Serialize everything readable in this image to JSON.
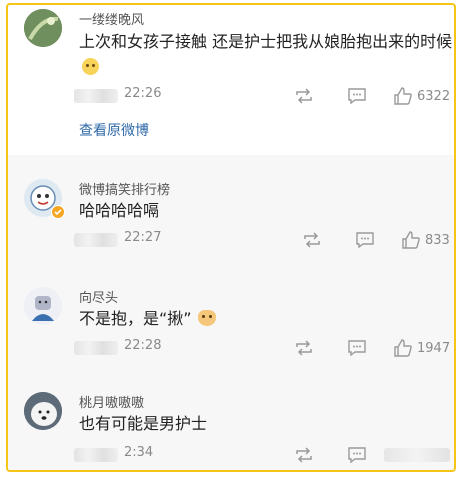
{
  "colors": {
    "frame": "#f5c518",
    "link": "#2f6aa8",
    "meta": "#8a8a8a"
  },
  "comments": [
    {
      "username": "一缕缕晚风",
      "text": "上次和女孩子接触 还是护士把我从娘胎抱出来的时候",
      "emoji": "blush-emoji-icon",
      "time": "22:26",
      "likes": "6322",
      "link": "查看原微博"
    },
    {
      "username": "微博搞笑排行榜",
      "text": "哈哈哈哈嗝",
      "time": "22:27",
      "likes": "833",
      "badge": "verified-badge-icon"
    },
    {
      "username": "向尽头",
      "text": "不是抱，是“揪”",
      "emoji": "dog-emoji-icon",
      "time": "22:28",
      "likes": "1947"
    },
    {
      "username": "桃月嗷嗷嗷",
      "text": "也有可能是男护士",
      "time": "2:34",
      "likes": ""
    }
  ]
}
